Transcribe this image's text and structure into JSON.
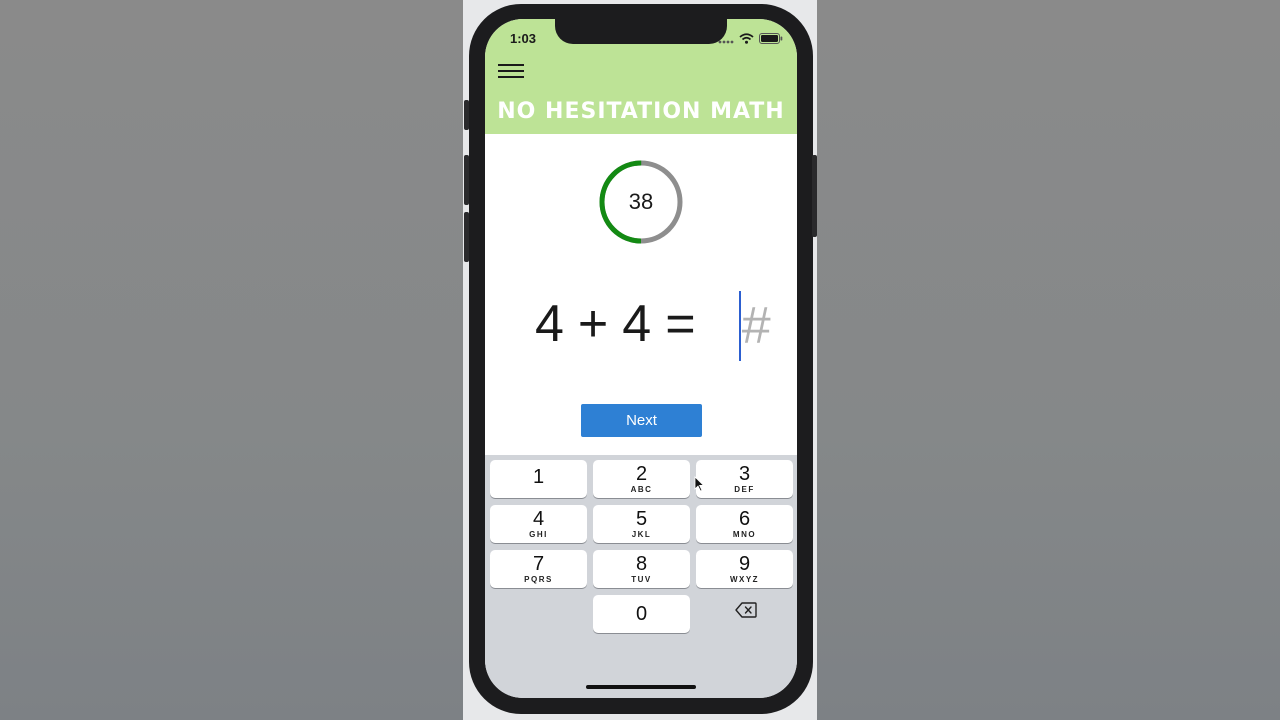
{
  "status_bar": {
    "time": "1:03"
  },
  "header": {
    "title": "NO HESITATION MATH",
    "background": "#bde396"
  },
  "timer": {
    "seconds_left": "38",
    "progress_fraction": 0.5,
    "active_color": "#138a13",
    "remaining_color": "#8e8e8e"
  },
  "problem": {
    "operand_a": "4",
    "operator": "+",
    "operand_b": "4",
    "equals": "="
  },
  "answer": {
    "value": "",
    "placeholder": "#"
  },
  "next_button": {
    "label": "Next",
    "color": "#2e80d4"
  },
  "keypad": {
    "keys": [
      {
        "digit": "1",
        "letters": ""
      },
      {
        "digit": "2",
        "letters": "ABC"
      },
      {
        "digit": "3",
        "letters": "DEF"
      },
      {
        "digit": "4",
        "letters": "GHI"
      },
      {
        "digit": "5",
        "letters": "JKL"
      },
      {
        "digit": "6",
        "letters": "MNO"
      },
      {
        "digit": "7",
        "letters": "PQRS"
      },
      {
        "digit": "8",
        "letters": "TUV"
      },
      {
        "digit": "9",
        "letters": "WXYZ"
      }
    ],
    "zero": "0",
    "delete_icon": "backspace-icon"
  }
}
